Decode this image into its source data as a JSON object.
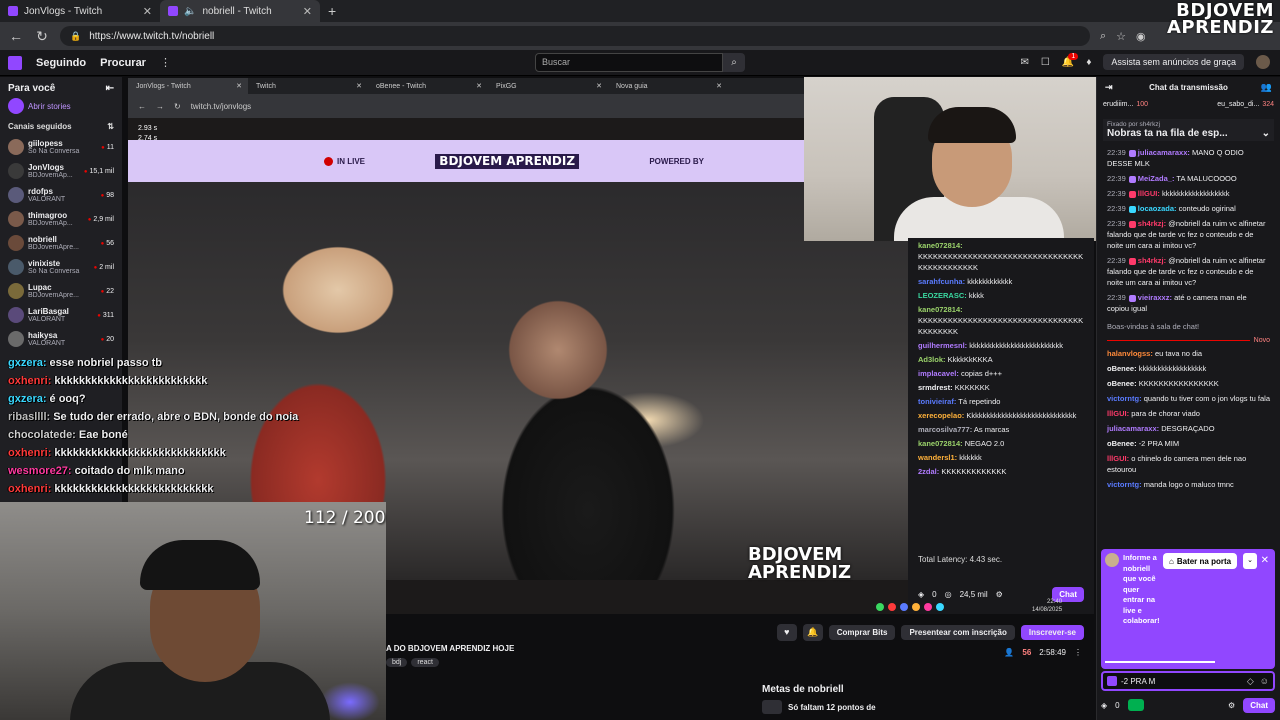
{
  "browser": {
    "tabs": [
      {
        "label": "JonVlogs - Twitch",
        "active": false
      },
      {
        "label": "nobriell - Twitch",
        "active": true
      }
    ],
    "url": "https://www.twitch.tv/nobriell"
  },
  "watermark": {
    "line1": "BDJOVEM",
    "line2": "APRENDIZ"
  },
  "topnav": {
    "following": "Seguindo",
    "browse": "Procurar",
    "search_placeholder": "Buscar",
    "notif_count": "1",
    "ad_free": "Assista sem anúncios de graça"
  },
  "sidebar": {
    "title": "Para você",
    "stories": "Abrir stories",
    "followed": "Canais seguidos",
    "channels": [
      {
        "name": "giilopess",
        "game": "Só Na Conversa",
        "viewers": "11"
      },
      {
        "name": "JonVlogs",
        "game": "BDJovemAp...",
        "viewers": "15,1 mil"
      },
      {
        "name": "rdofps",
        "game": "VALORANT",
        "viewers": "98"
      },
      {
        "name": "thimagroo",
        "game": "BDJovemAp...",
        "viewers": "2,9 mil"
      },
      {
        "name": "nobriell",
        "game": "BDJovemApre...",
        "viewers": "56"
      },
      {
        "name": "vinixiste",
        "game": "Só Na Conversa",
        "viewers": "2 mil"
      },
      {
        "name": "Lupac",
        "game": "BDJovemApre...",
        "viewers": "22"
      },
      {
        "name": "LariBasgal",
        "game": "VALORANT",
        "viewers": "311"
      },
      {
        "name": "haikysa",
        "game": "VALORANT",
        "viewers": "20"
      }
    ]
  },
  "inner_browser": {
    "tabs": [
      "JonVlogs - Twitch",
      "Twitch",
      "oBenee - Twitch",
      "PixGG",
      "Nova guia"
    ],
    "url": "twitch.tv/jonvlogs",
    "stats": [
      "2.93 s",
      "2.74 s"
    ]
  },
  "stream_banner": {
    "live": "IN LIVE",
    "logo": "BDJOVEM APRENDIZ",
    "powered": "POWERED BY"
  },
  "video_logo": {
    "line1": "BDJOVEM",
    "line2": "APRENDIZ"
  },
  "goal_counter": "112 / 200",
  "overlay_chat": [
    {
      "user": "gxzera:",
      "msg": "esse nobriel passo tb",
      "color": "#3ad8ff"
    },
    {
      "user": "oxhenri:",
      "msg": "kkkkkkkkkkkkkkkkkkkkkkkkk",
      "color": "#ff3a3a"
    },
    {
      "user": "gxzera:",
      "msg": "é ooq?",
      "color": "#3ad8ff"
    },
    {
      "user": "ribasllll:",
      "msg": "Se tudo der errado, abre o BDN, bonde do noia",
      "color": "#bdbdbd"
    },
    {
      "user": "chocolatede:",
      "msg": "Eae boné",
      "color": "#cfcfcf"
    },
    {
      "user": "oxhenri:",
      "msg": "kkkkkkkkkkkkkkkkkkkkkkkkkkkk",
      "color": "#ff3a3a"
    },
    {
      "user": "wesmore27:",
      "msg": "coitado do mlk mano",
      "color": "#ff3aa0"
    },
    {
      "user": "oxhenri:",
      "msg": "kkkkkkkkkkkkkkkkkkkkkkkkkk",
      "color": "#ff3a3a"
    }
  ],
  "middle_chat": {
    "lines": [
      {
        "user": "kane072814:",
        "msg": "KKKKKKKKKKKKKKKKKKKKKKKKKKKKKKKKKKKKKKKKKKKKK",
        "color": "#9bd36b"
      },
      {
        "user": "sarahfcunha:",
        "msg": "kkkkkkkkkkkk",
        "color": "#5a7bff"
      },
      {
        "user": "LEOZERASC:",
        "msg": "kkkk",
        "color": "#3ad8a0"
      },
      {
        "user": "kane072814:",
        "msg": "KKKKKKKKKKKKKKKKKKKKKKKKKKKKKKKKKKKKKKKKK",
        "color": "#9bd36b"
      },
      {
        "user": "guilhermesnl:",
        "msg": "kkkkkkkkkkkkkkkkkkkkkkkkk",
        "color": "#b07bff"
      },
      {
        "user": "Ad3lok:",
        "msg": "KkkkKkKKKA",
        "color": "#9bd36b"
      },
      {
        "user": "implacavel:",
        "msg": "copias d+++",
        "color": "#b07bff"
      },
      {
        "user": "srmdrest:",
        "msg": "KKKKKKK",
        "color": "#efeff1"
      },
      {
        "user": "tonivieiraf:",
        "msg": "Tá repetindo",
        "color": "#5a7bff"
      },
      {
        "user": "xerecopelao:",
        "msg": "Kkkkkkkkkkkkkkkkkkkkkkkkkkkkk",
        "color": "#ffb13a"
      },
      {
        "user": "marcosilva777:",
        "msg": "As marcas",
        "color": "#adadb8"
      },
      {
        "user": "kane072814:",
        "msg": "NEGAO 2.0",
        "color": "#9bd36b"
      },
      {
        "user": "wandersl1:",
        "msg": "kkkkkk",
        "color": "#ffb13a"
      },
      {
        "user": "2zdal:",
        "msg": "KKKKKKKKKKKKK",
        "color": "#b07bff"
      }
    ],
    "latency": "Total Latency: 4.43 sec.",
    "points": "0",
    "viewers": "24,5 mil",
    "chat_btn": "Chat"
  },
  "clock": {
    "time": "22:40",
    "date": "14/08/2025"
  },
  "below_video": {
    "title": "A DO BDJOVEM APRENDIZ HOJE",
    "tags": [
      "bdj",
      "react"
    ],
    "bits": "Comprar Bits",
    "gift": "Presentear com inscrição",
    "subscribe": "Inscrever-se",
    "viewers": "56",
    "uptime": "2:58:49",
    "goals_title": "Metas de nobriell",
    "goal_text": "Só faltam 12 pontos de"
  },
  "right_chat": {
    "title": "Chat da transmissão",
    "hype": [
      {
        "name": "erudiiim...",
        "count": "100"
      },
      {
        "name": "eu_sabo_di...",
        "count": "324"
      }
    ],
    "pinned_by": "Fixado por",
    "pinned_user": "sh4rkzj",
    "pinned_msg": "Nobras ta na fila de esp...",
    "lines": [
      {
        "t": "22:39",
        "user": "juliacamaraxx:",
        "msg": "MANO Q ODIO DESSE MLK",
        "color": "#b07bff"
      },
      {
        "t": "22:39",
        "user": "MeiZada_:",
        "msg": "TA MALUCOOOO",
        "color": "#b07bff"
      },
      {
        "t": "22:39",
        "user": "lllGUI:",
        "msg": "kkkkkkkkkkkkkkkkkk",
        "color": "#ff3a6a"
      },
      {
        "t": "22:39",
        "user": "locaozada:",
        "msg": "conteudo ogirinal",
        "color": "#3ad8ff"
      },
      {
        "t": "22:39",
        "user": "sh4rkzj:",
        "msg": "@nobriell da ruim vc alfinetar falando que de tarde vc fez o conteudo e de noite um cara ai imitou vc?",
        "color": "#ff3a6a"
      },
      {
        "t": "22:39",
        "user": "sh4rkzj:",
        "msg": "@nobriell da ruim vc alfinetar falando que de tarde vc fez o conteudo e de noite um cara ai imitou vc?",
        "color": "#ff3a6a"
      },
      {
        "t": "22:39",
        "user": "vieiraxxz:",
        "msg": "até o camera man ele copiou igual",
        "color": "#b07bff"
      }
    ],
    "welcome": "Boas-vindas à sala de chat!",
    "new_label": "Novo",
    "new_lines": [
      {
        "user": "halanvlogss:",
        "msg": "eu tava no dia",
        "color": "#ff8a3a"
      },
      {
        "user": "oBenee:",
        "msg": "kkkkkkkkkkkkkkkkkk",
        "color": "#efeff1"
      },
      {
        "user": "oBenee:",
        "msg": "KKKKKKKKKKKKKKKK",
        "color": "#efeff1"
      },
      {
        "user": "victorntg:",
        "msg": "quando tu tiver com o jon vlogs tu fala",
        "color": "#5a7bff"
      },
      {
        "user": "lllGUI:",
        "msg": "para de chorar viado",
        "color": "#ff3a6a"
      },
      {
        "user": "juliacamaraxx:",
        "msg": "DESGRAÇADO",
        "color": "#b07bff"
      },
      {
        "user": "oBenee:",
        "msg": "-2 PRA MIM",
        "color": "#efeff1"
      },
      {
        "user": "lllGUI:",
        "msg": "o chinelo do camera men dele nao estourou",
        "color": "#ff3a6a"
      },
      {
        "user": "victorntg:",
        "msg": "manda logo o maluco tmnc",
        "color": "#5a7bff"
      }
    ],
    "collab_text": "Informe a nobriell que você quer entrar na live e colaborar!",
    "knock": "Bater na porta",
    "input_value": "-2 PRA M",
    "points": "0",
    "chat_btn": "Chat"
  }
}
